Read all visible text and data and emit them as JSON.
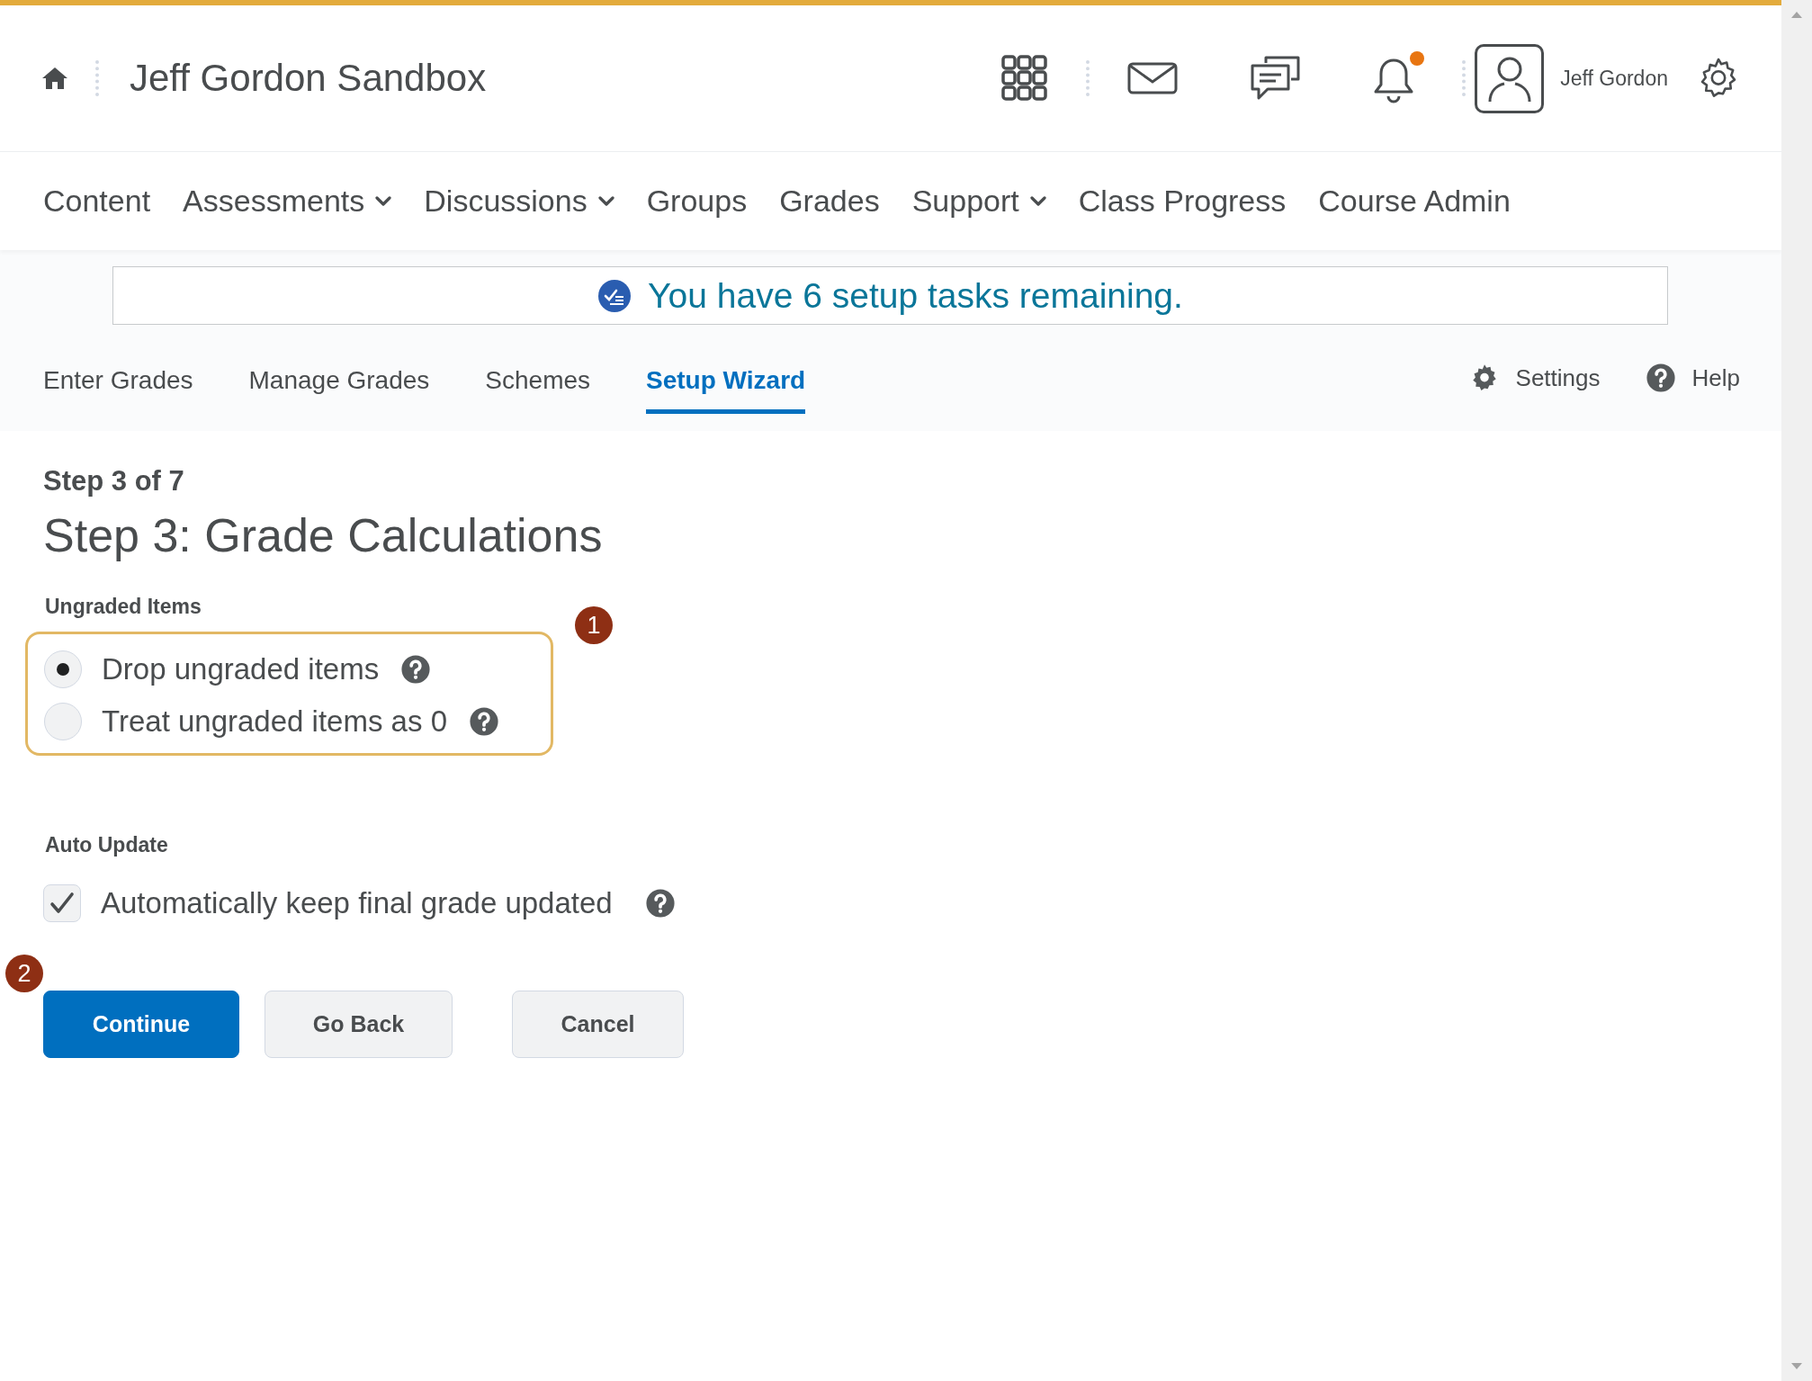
{
  "header": {
    "title": "Jeff Gordon Sandbox",
    "user_name": "Jeff Gordon",
    "notifications_unread": true
  },
  "nav": [
    {
      "label": "Content",
      "dropdown": false
    },
    {
      "label": "Assessments",
      "dropdown": true
    },
    {
      "label": "Discussions",
      "dropdown": true
    },
    {
      "label": "Groups",
      "dropdown": false
    },
    {
      "label": "Grades",
      "dropdown": false
    },
    {
      "label": "Support",
      "dropdown": true
    },
    {
      "label": "Class Progress",
      "dropdown": false
    },
    {
      "label": "Course Admin",
      "dropdown": false
    }
  ],
  "banner": {
    "text": "You have 6 setup tasks remaining."
  },
  "tabs": [
    {
      "label": "Enter Grades",
      "selected": false
    },
    {
      "label": "Manage Grades",
      "selected": false
    },
    {
      "label": "Schemes",
      "selected": false
    },
    {
      "label": "Setup Wizard",
      "selected": true
    }
  ],
  "tab_actions": [
    {
      "label": "Settings",
      "kind": "settings"
    },
    {
      "label": "Help",
      "kind": "help"
    }
  ],
  "wizard": {
    "step_label": "Step 3 of 7",
    "heading": "Step 3: Grade Calculations",
    "ungraded": {
      "label": "Ungraded Items",
      "options": [
        {
          "label": "Drop ungraded items",
          "selected": true
        },
        {
          "label": "Treat ungraded items as 0",
          "selected": false
        }
      ]
    },
    "auto_update": {
      "label": "Auto Update",
      "option": {
        "label": "Automatically keep final grade updated",
        "checked": true
      }
    },
    "buttons": [
      {
        "label": "Continue",
        "kind": "primary"
      },
      {
        "label": "Go Back",
        "kind": "secondary"
      },
      {
        "label": "Cancel",
        "kind": "secondary"
      }
    ]
  },
  "callouts": [
    "1",
    "2"
  ]
}
